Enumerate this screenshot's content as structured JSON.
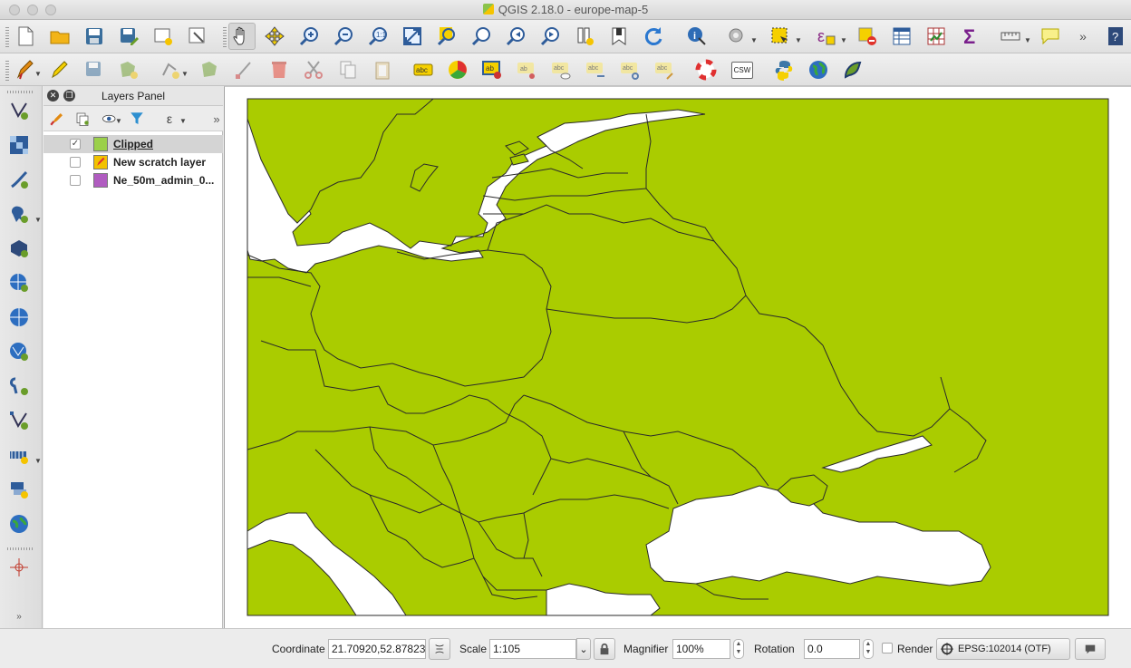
{
  "window": {
    "title": "QGIS 2.18.0 - europe-map-5"
  },
  "colors": {
    "land": "#aacc00",
    "border": "#2a2a2a",
    "sea": "#ffffff",
    "scratch_swatch": "#f2c200",
    "admin_swatch": "#b05cc0",
    "clipped_swatch": "#9bd04a"
  },
  "toolbar1": {
    "icons": [
      "new-project-icon",
      "open-project-icon",
      "save-project-icon",
      "save-as-icon",
      "new-print-composer-icon",
      "composer-manager-icon",
      "pan-icon",
      "pan-to-selection-icon",
      "zoom-in-icon",
      "zoom-out-icon",
      "zoom-actual-size-icon",
      "zoom-full-icon",
      "zoom-to-selection-icon",
      "zoom-to-layer-icon",
      "zoom-last-icon",
      "zoom-next-icon",
      "new-map-view-icon",
      "new-bookmark-icon",
      "refresh-icon",
      "identify-icon",
      "run-action-icon",
      "select-features-icon",
      "select-by-expression-icon",
      "deselect-icon",
      "attribute-table-icon",
      "field-calculator-icon",
      "statistics-icon",
      "measure-icon",
      "map-tips-icon",
      "overflow-chevron-icon",
      "help-icon"
    ]
  },
  "toolbar2": {
    "icons": [
      "current-edits-icon",
      "toggle-editing-icon",
      "save-edits-icon",
      "add-feature-icon",
      "vertex-tool-icon",
      "move-feature-icon",
      "node-tool-icon",
      "delete-selected-icon",
      "cut-features-icon",
      "copy-features-icon",
      "paste-features-icon",
      "label-icon",
      "diagram-icon",
      "highlight-label-icon",
      "pin-label-icon",
      "show-hide-label-icon",
      "move-label-icon",
      "rotate-label-icon",
      "change-label-icon",
      "plugin-lifebuoy-icon",
      "csw-icon",
      "python-console-icon",
      "globe-icon",
      "geometry-checker-icon"
    ],
    "csw_label": "CSW"
  },
  "left_toolbar": {
    "icons": [
      "add-vector-layer-icon",
      "add-raster-layer-icon",
      "add-delimited-text-icon",
      "add-postgis-icon",
      "add-spatialite-icon",
      "add-wms-icon",
      "add-wcs-icon",
      "add-wfs-icon",
      "new-shapefile-icon",
      "new-gpx-icon",
      "add-virtual-layer-icon",
      "add-mssql-icon",
      "add-oracle-icon",
      "georeferencer-icon",
      "expand-icon"
    ]
  },
  "layers_panel": {
    "title": "Layers Panel",
    "layers": [
      {
        "name": "Clipped",
        "checked": true,
        "selected": true,
        "swatch": "#9bd04a"
      },
      {
        "name": "New scratch layer",
        "checked": false,
        "selected": false,
        "swatch": "#f2c200"
      },
      {
        "name": "Ne_50m_admin_0...",
        "checked": false,
        "selected": false,
        "swatch": "#b05cc0"
      }
    ]
  },
  "status": {
    "coordinate_label": "Coordinate",
    "coordinate_value": "21.70920,52.87823",
    "scale_label": "Scale",
    "scale_value": "1:105",
    "magnifier_label": "Magnifier",
    "magnifier_value": "100%",
    "rotation_label": "Rotation",
    "rotation_value": "0.0",
    "render_label": "Render",
    "render_checked": false,
    "crs_value": "EPSG:102014 (OTF)"
  }
}
